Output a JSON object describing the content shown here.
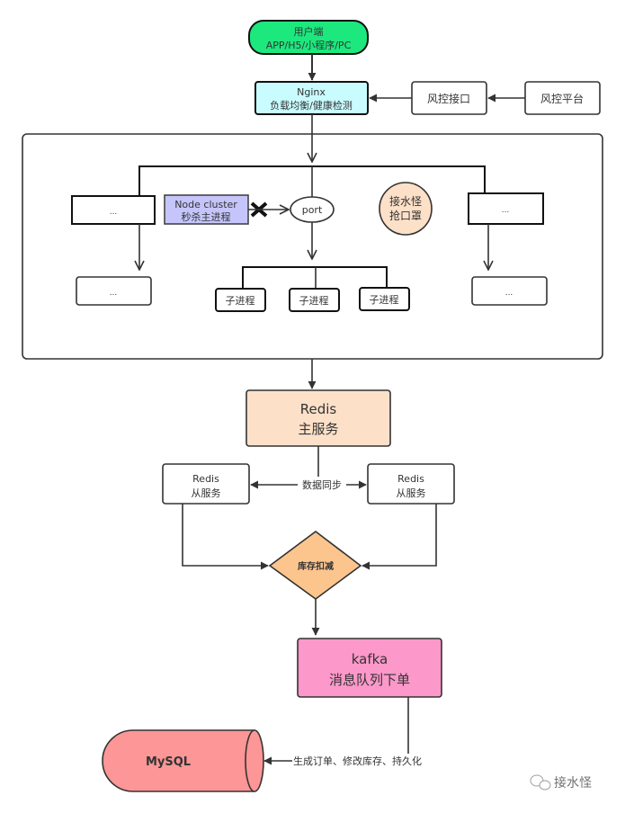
{
  "diagram": {
    "colors": {
      "client": "#1ce87e",
      "nginx": "#c9fcff",
      "node_cluster": "#c5c5fb",
      "watermark_circle": "#fde0c8",
      "redis_master": "#fde0c8",
      "decision": "#fcc58e",
      "kafka": "#fd98ca",
      "mysql": "#fd9696",
      "stroke": "#333333"
    },
    "client": {
      "line1": "用户端",
      "line2": "APP/H5/小程序/PC"
    },
    "nginx": {
      "line1": "Nginx",
      "line2": "负载均衡/健康检测"
    },
    "risk_interface": {
      "label": "风控接口"
    },
    "risk_platform": {
      "label": "风控平台"
    },
    "cluster": {
      "left_top": {
        "label": "..."
      },
      "left_bottom": {
        "label": "..."
      },
      "right_top": {
        "label": "..."
      },
      "right_bottom": {
        "label": "..."
      },
      "node_master": {
        "line1": "Node cluster",
        "line2": "秒杀主进程"
      },
      "port": {
        "label": "port"
      },
      "stamp": {
        "line1": "接水怪",
        "line2": "抢口罩"
      },
      "children": [
        {
          "label": "子进程"
        },
        {
          "label": "子进程"
        },
        {
          "label": "子进程"
        }
      ]
    },
    "redis_master": {
      "line1": "Redis",
      "line2": "主服务"
    },
    "redis_slave_left": {
      "line1": "Redis",
      "line2": "从服务"
    },
    "redis_slave_right": {
      "line1": "Redis",
      "line2": "从服务"
    },
    "sync_label": "数据同步",
    "decision": {
      "label": "库存扣减"
    },
    "kafka": {
      "line1": "kafka",
      "line2": "消息队列下单"
    },
    "mysql": {
      "label": "MySQL"
    },
    "persist_label": "生成订单、修改库存、持久化",
    "watermark": {
      "label": "接水怪"
    }
  }
}
